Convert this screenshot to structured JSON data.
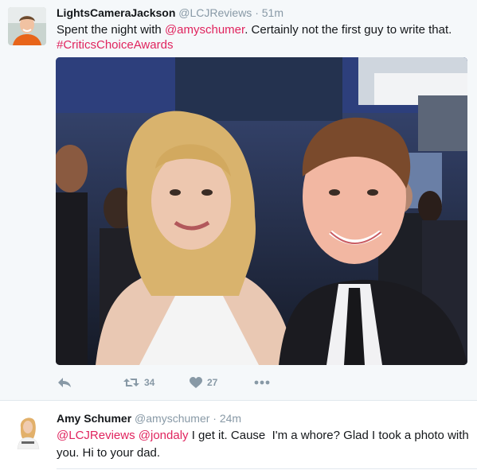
{
  "tweet": {
    "author_name": "LightsCameraJackson",
    "author_handle": "@LCJReviews",
    "separator": "·",
    "time": "51m",
    "text_before_mention": "Spent the night with ",
    "mention": "@amyschumer",
    "text_after_mention": ". Certainly not the first guy to write that.",
    "hashtag": "#CriticsChoiceAwards",
    "avatar_icon": "profile-photo-young-man",
    "photo_icon": "selfie-photo-red-carpet",
    "actions": {
      "reply_icon": "reply-icon",
      "retweet_icon": "retweet-icon",
      "retweet_count": "34",
      "like_icon": "heart-icon",
      "like_count": "27",
      "more_icon": "more-icon"
    }
  },
  "reply": {
    "author_name": "Amy Schumer",
    "author_handle": "@amyschumer",
    "separator": "·",
    "time": "24m",
    "mention1": "@LCJReviews",
    "space": " ",
    "mention2": "@jondaly",
    "text_line": " I get it. Cause  I'm a whore? Glad I took a photo with you. Hi to your dad.",
    "avatar_icon": "profile-photo-woman"
  },
  "colors": {
    "accent": "#e0245e",
    "muted": "#8899a6",
    "text": "#14171a",
    "background_main": "#f5f8fa"
  }
}
